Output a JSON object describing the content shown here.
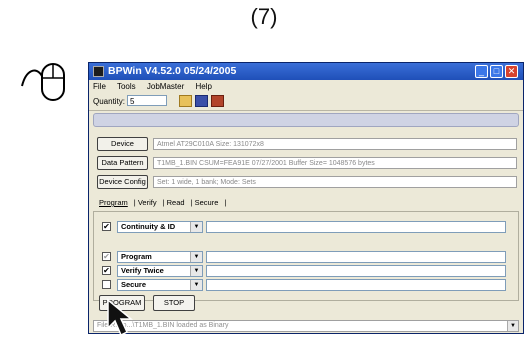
{
  "step_label": "(7)",
  "window": {
    "title": "BPWin  V4.52.0  05/24/2005",
    "controls": [
      "_",
      "□",
      "✕"
    ]
  },
  "menu": [
    "File",
    "Tools",
    "JobMaster",
    "Help"
  ],
  "toolbar": {
    "quantity_label": "Quantity:",
    "quantity_value": "5"
  },
  "info_rows": [
    {
      "button": "Device",
      "value": "Atmel AT29C010A   Size: 131072x8"
    },
    {
      "button": "Data Pattern",
      "value": "T1MB_1.BIN    CSUM=FEA91E    07/27/2001    Buffer Size= 1048576 bytes"
    },
    {
      "button": "Device Config",
      "value": "Set: 1 wide, 1 bank;  Mode: Sets"
    }
  ],
  "tabs": [
    "Program",
    "Verify",
    "Read",
    "Secure"
  ],
  "operations": [
    {
      "label": "Continuity & ID",
      "checked": "✔"
    },
    {
      "label": "Program",
      "checked": "✔"
    },
    {
      "label": "Verify Twice",
      "checked": "✔"
    },
    {
      "label": "Secure",
      "checked": ""
    }
  ],
  "buttons": {
    "program": "PROGRAM",
    "stop": "STOP"
  },
  "status": "File R:\\Jo...\\T1MB_1.BIN loaded as Binary"
}
